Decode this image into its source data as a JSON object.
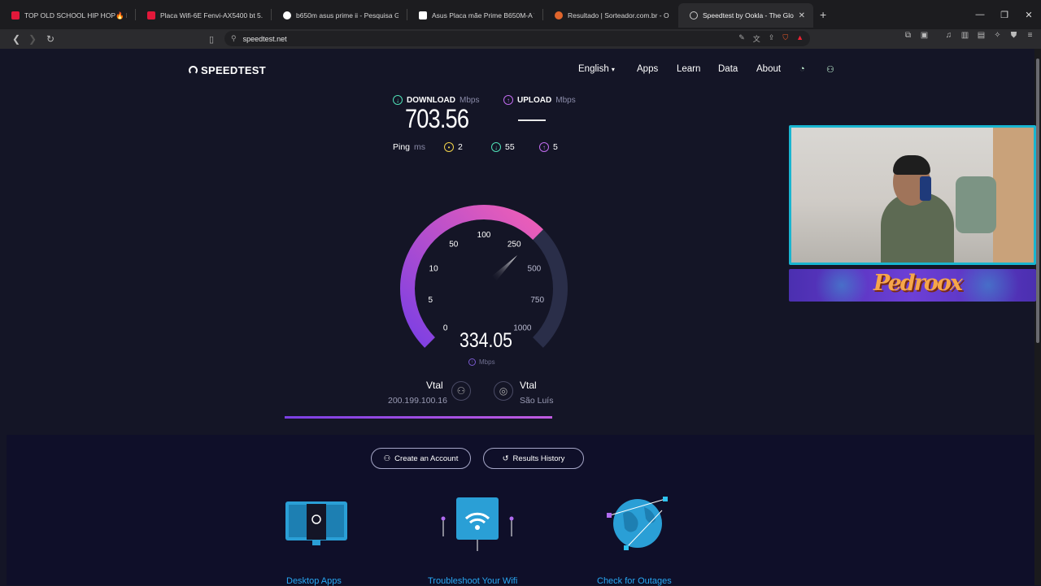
{
  "browser": {
    "tabs": [
      {
        "title": "TOP OLD SCHOOL HIP HOP🔥 Ice",
        "favicon_color": "#e2183a"
      },
      {
        "title": "Placa Wifi-6E Fenvi-AX5400 bt 5.2 - Y",
        "favicon_color": "#e2183a"
      },
      {
        "title": "b650m asus prime ii - Pesquisa Goog",
        "favicon_color": "#ffffff"
      },
      {
        "title": "Asus Placa mãe Prime B650M-A WIFI",
        "favicon_color": "#ffffff"
      },
      {
        "title": "Resultado | Sorteador.com.br - O Site",
        "favicon_color": "#e0652c"
      },
      {
        "title": "Speedtest by Ookla - The Global",
        "favicon_color": "#cccccc",
        "active": true
      }
    ],
    "new_tab_icon": "plus-icon",
    "url": "speedtest.net",
    "window_controls": [
      "minimize-icon",
      "restore-icon",
      "close-icon"
    ]
  },
  "site": {
    "logo_text": "SPEEDTEST",
    "nav": {
      "language": "English",
      "apps": "Apps",
      "learn": "Learn",
      "data": "Data",
      "about": "About"
    }
  },
  "result": {
    "download_label": "DOWNLOAD",
    "download_unit": "Mbps",
    "download_value": "703.56",
    "upload_label": "UPLOAD",
    "upload_unit": "Mbps",
    "ping_label": "Ping",
    "ping_unit": "ms",
    "ping_idle": "2",
    "ping_download": "55",
    "ping_upload": "5"
  },
  "gauge": {
    "current_value": "334.05",
    "unit": "Mbps",
    "ticks": [
      "0",
      "5",
      "10",
      "50",
      "100",
      "250",
      "500",
      "750",
      "1000"
    ],
    "accent_start": "#7b3fe4",
    "accent_end": "#f05fb6"
  },
  "connection": {
    "client_isp": "Vtal",
    "client_ip": "200.199.100.16",
    "server_name": "Vtal",
    "server_location": "São Luís",
    "progress": 1.0
  },
  "actions": {
    "create_account": "Create an Account",
    "results_history": "Results History"
  },
  "features": {
    "desktop_apps": "Desktop Apps",
    "troubleshoot_wifi": "Troubleshoot Your Wifi",
    "check_outages": "Check for Outages"
  },
  "overlay": {
    "banner_text": "Pedroox"
  }
}
